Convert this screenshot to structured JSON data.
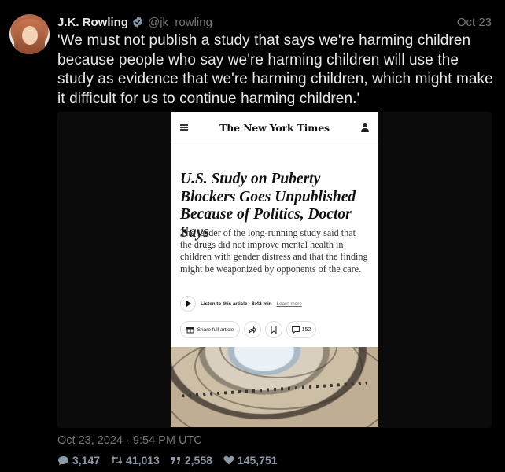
{
  "author": {
    "name": "J.K. Rowling",
    "handle": "@jk_rowling",
    "date": "Oct 23"
  },
  "tweet": {
    "text": "'We must not publish a study that says we're harming children because people who say we're harming children will use the study as evidence that we're harming children, which might make it difficult for us to continue harming children.'"
  },
  "article": {
    "masthead": "The New York Times",
    "headline": "U.S. Study on Puberty Blockers Goes Unpublished Because of Politics, Doctor Says",
    "dek": "The leader of the long-running study said that the drugs did not improve mental health in children with gender distress and that the finding might be weaponized by opponents of the care.",
    "listen_label": "Listen to this article · 8:42 min",
    "learn_more": "Learn more",
    "share_label": "Share full article",
    "comment_count": "152"
  },
  "meta": {
    "timestamp": "Oct 23, 2024 · 9:54 PM UTC"
  },
  "metrics": {
    "replies": "3,147",
    "retweets": "41,013",
    "quotes": "2,558",
    "likes": "145,751"
  },
  "colors": {
    "background": "#000000",
    "text": "#e7e9ea",
    "muted": "#71767b",
    "verified": "#829aab"
  }
}
